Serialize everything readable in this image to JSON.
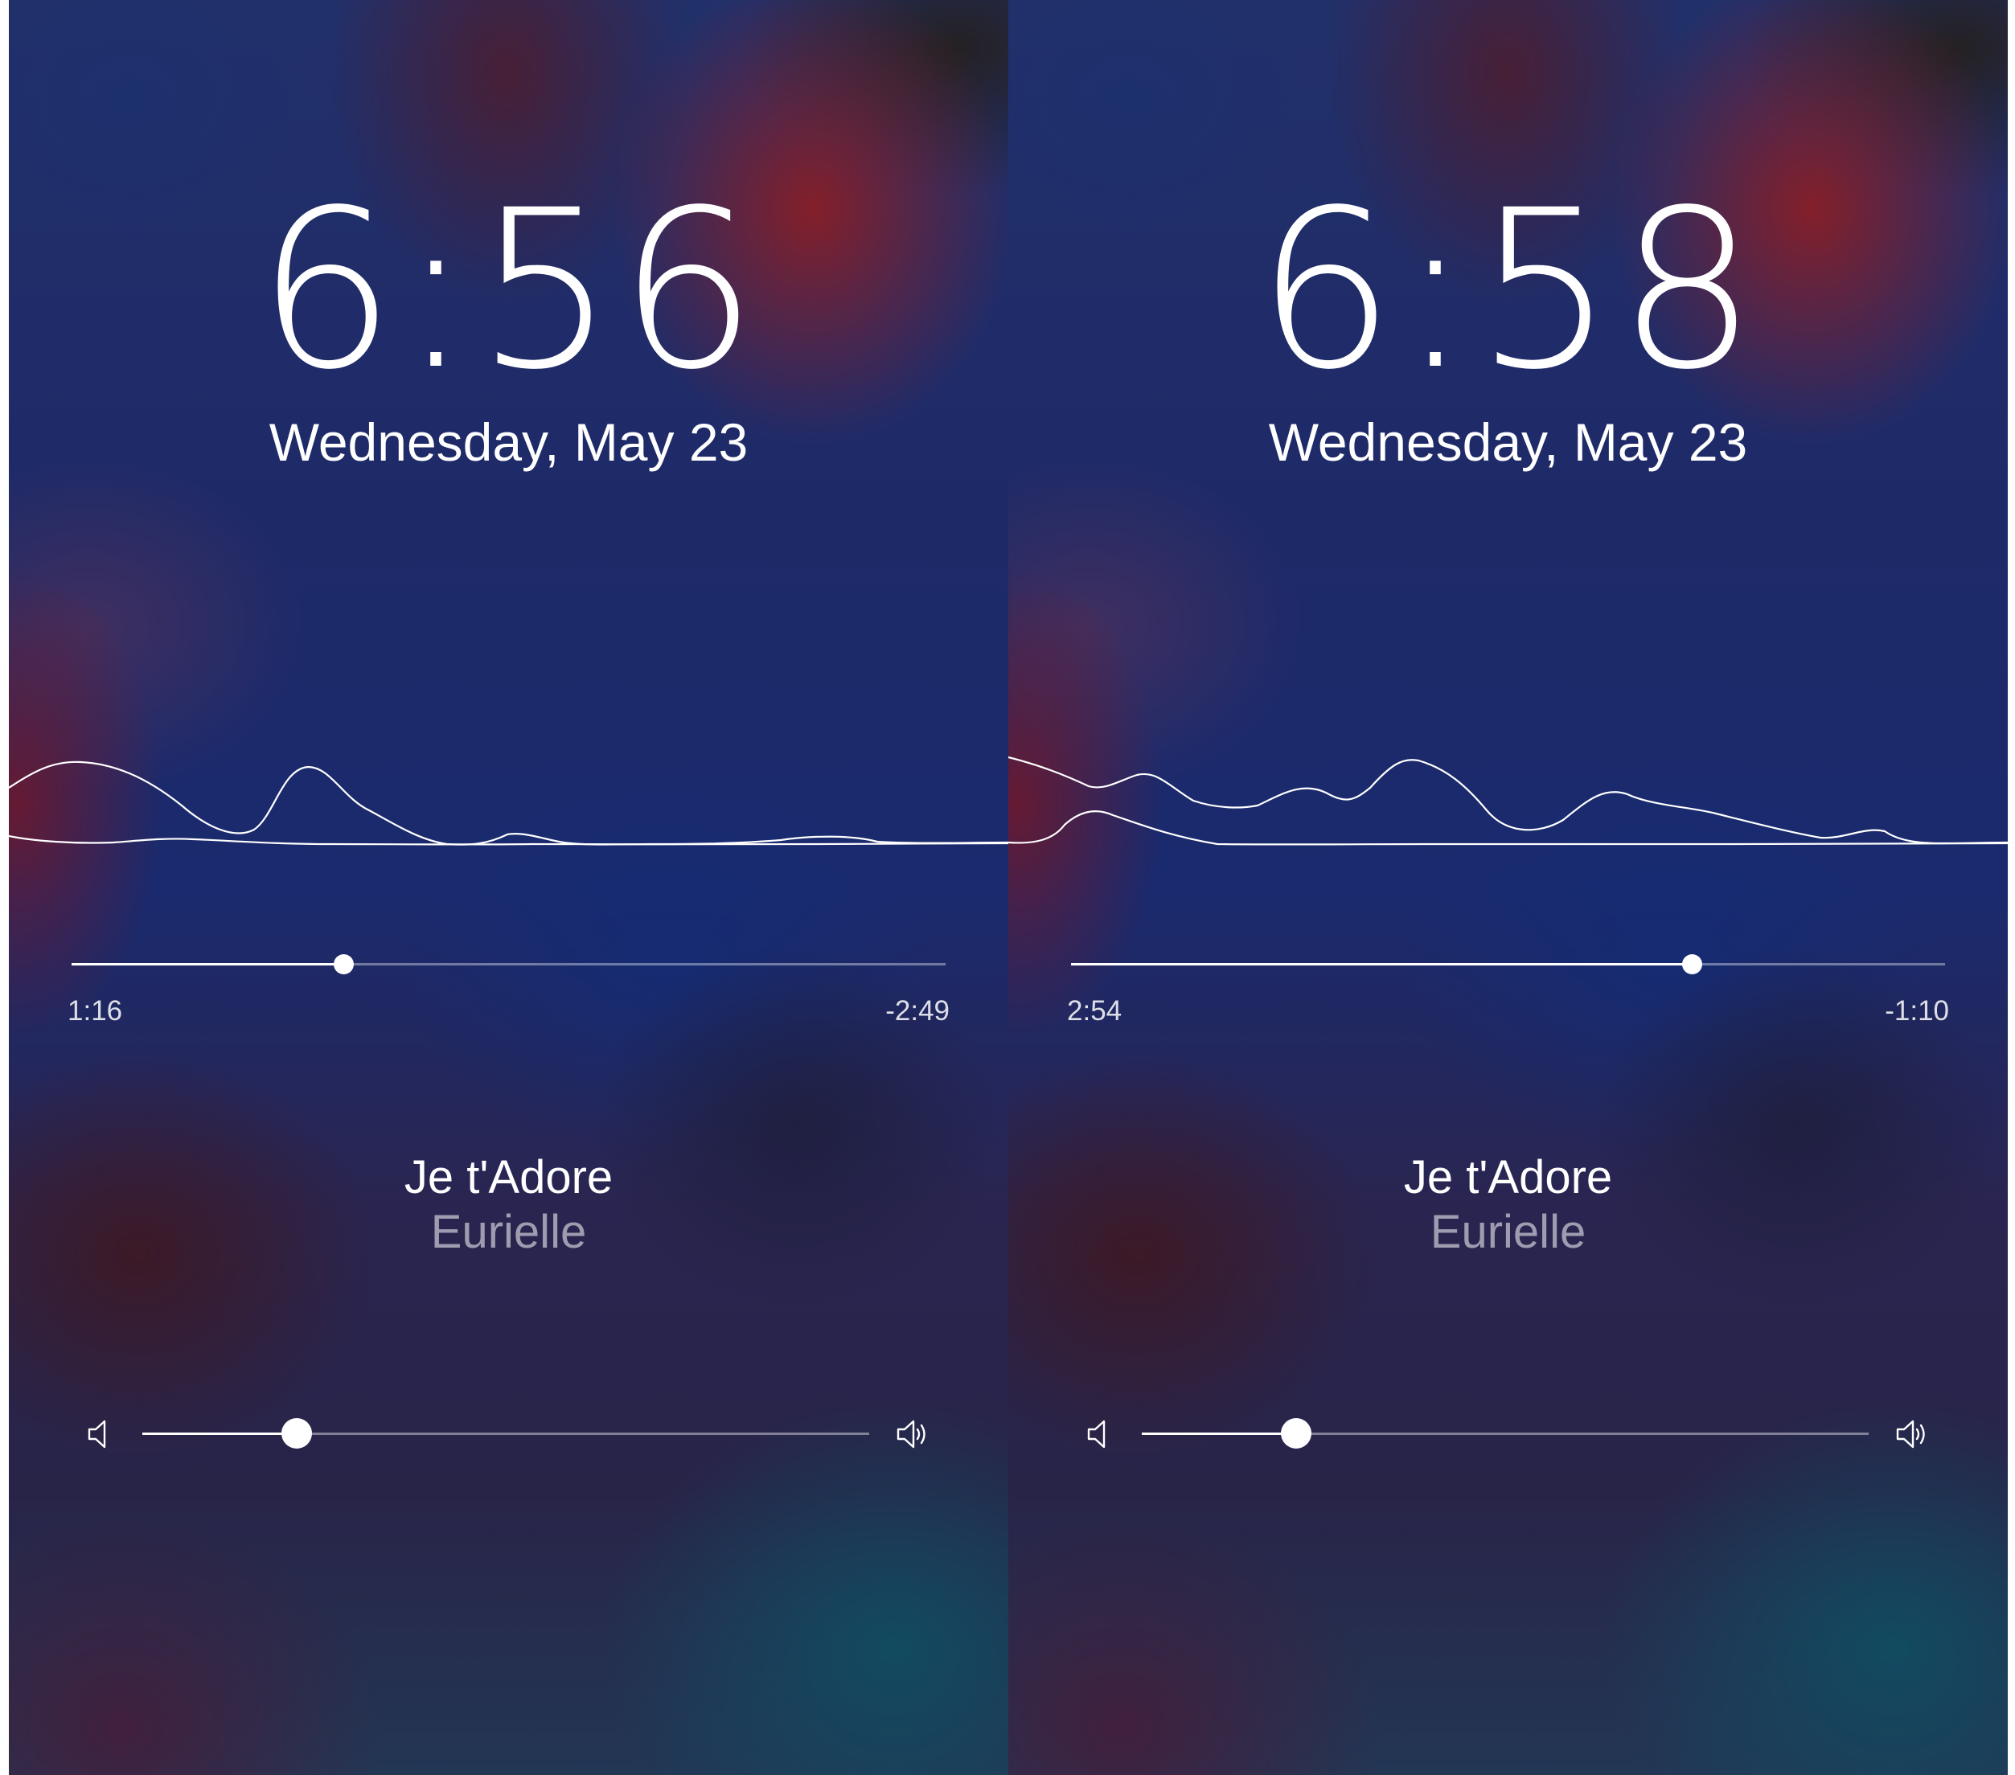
{
  "screens": [
    {
      "clock": "6:56",
      "date": "Wednesday, May 23",
      "progress": {
        "elapsed": "1:16",
        "remaining": "-2:49",
        "fraction": 0.311
      },
      "song": {
        "title": "Je t'Adore",
        "artist": "Eurielle"
      },
      "volume": {
        "fraction": 0.212,
        "min_icon": "speaker-low-icon",
        "max_icon": "speaker-high-icon"
      }
    },
    {
      "clock": "6:58",
      "date": "Wednesday, May 23",
      "progress": {
        "elapsed": "2:54",
        "remaining": "-1:10",
        "fraction": 0.71
      },
      "song": {
        "title": "Je t'Adore",
        "artist": "Eurielle"
      },
      "volume": {
        "fraction": 0.212,
        "min_icon": "speaker-low-icon",
        "max_icon": "speaker-high-icon"
      }
    }
  ],
  "colors": {
    "foreground": "#ffffff",
    "artist_text": "#a9aab8",
    "background_blue": "#1d2a5a",
    "background_red": "#8c1e24",
    "background_teal": "#0e5064"
  }
}
